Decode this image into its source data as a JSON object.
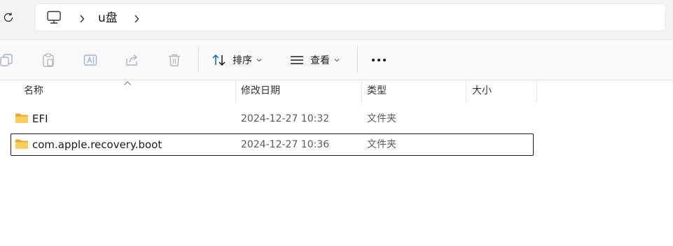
{
  "address_bar": {
    "crumbs": [
      {
        "icon": "computer-icon"
      },
      {
        "label": "u盘"
      }
    ]
  },
  "toolbar": {
    "sort_label": "排序",
    "view_label": "查看",
    "more_label": "•••"
  },
  "columns": {
    "name": "名称",
    "modified": "修改日期",
    "type": "类型",
    "size": "大小"
  },
  "rows": [
    {
      "name": "EFI",
      "modified": "2024-12-27 10:32",
      "type": "文件夹",
      "size": ""
    },
    {
      "name": "com.apple.recovery.boot",
      "modified": "2024-12-27 10:36",
      "type": "文件夹",
      "size": ""
    }
  ],
  "colors": {
    "accent": "#0067c0",
    "folder": "#f5c452"
  }
}
